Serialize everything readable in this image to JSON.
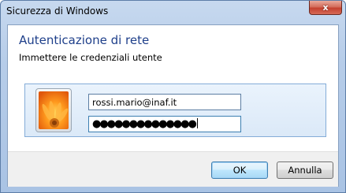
{
  "window": {
    "title": "Sicurezza di Windows",
    "close_glyph": "x"
  },
  "dialog": {
    "heading": "Autenticazione di rete",
    "instruction": "Immettere le credenziali utente"
  },
  "credentials": {
    "user_picture_icon": "flower-user-tile-icon",
    "username_value": "rossi.mario@inaf.it",
    "password_mask": "●●●●●●●●●●●●●●"
  },
  "buttons": {
    "ok_label": "OK",
    "cancel_label": "Annulla"
  },
  "colors": {
    "heading": "#1e3f8a",
    "frame": "#b7cde9",
    "tile_border": "#84acd8",
    "close_red": "#c4412f"
  }
}
